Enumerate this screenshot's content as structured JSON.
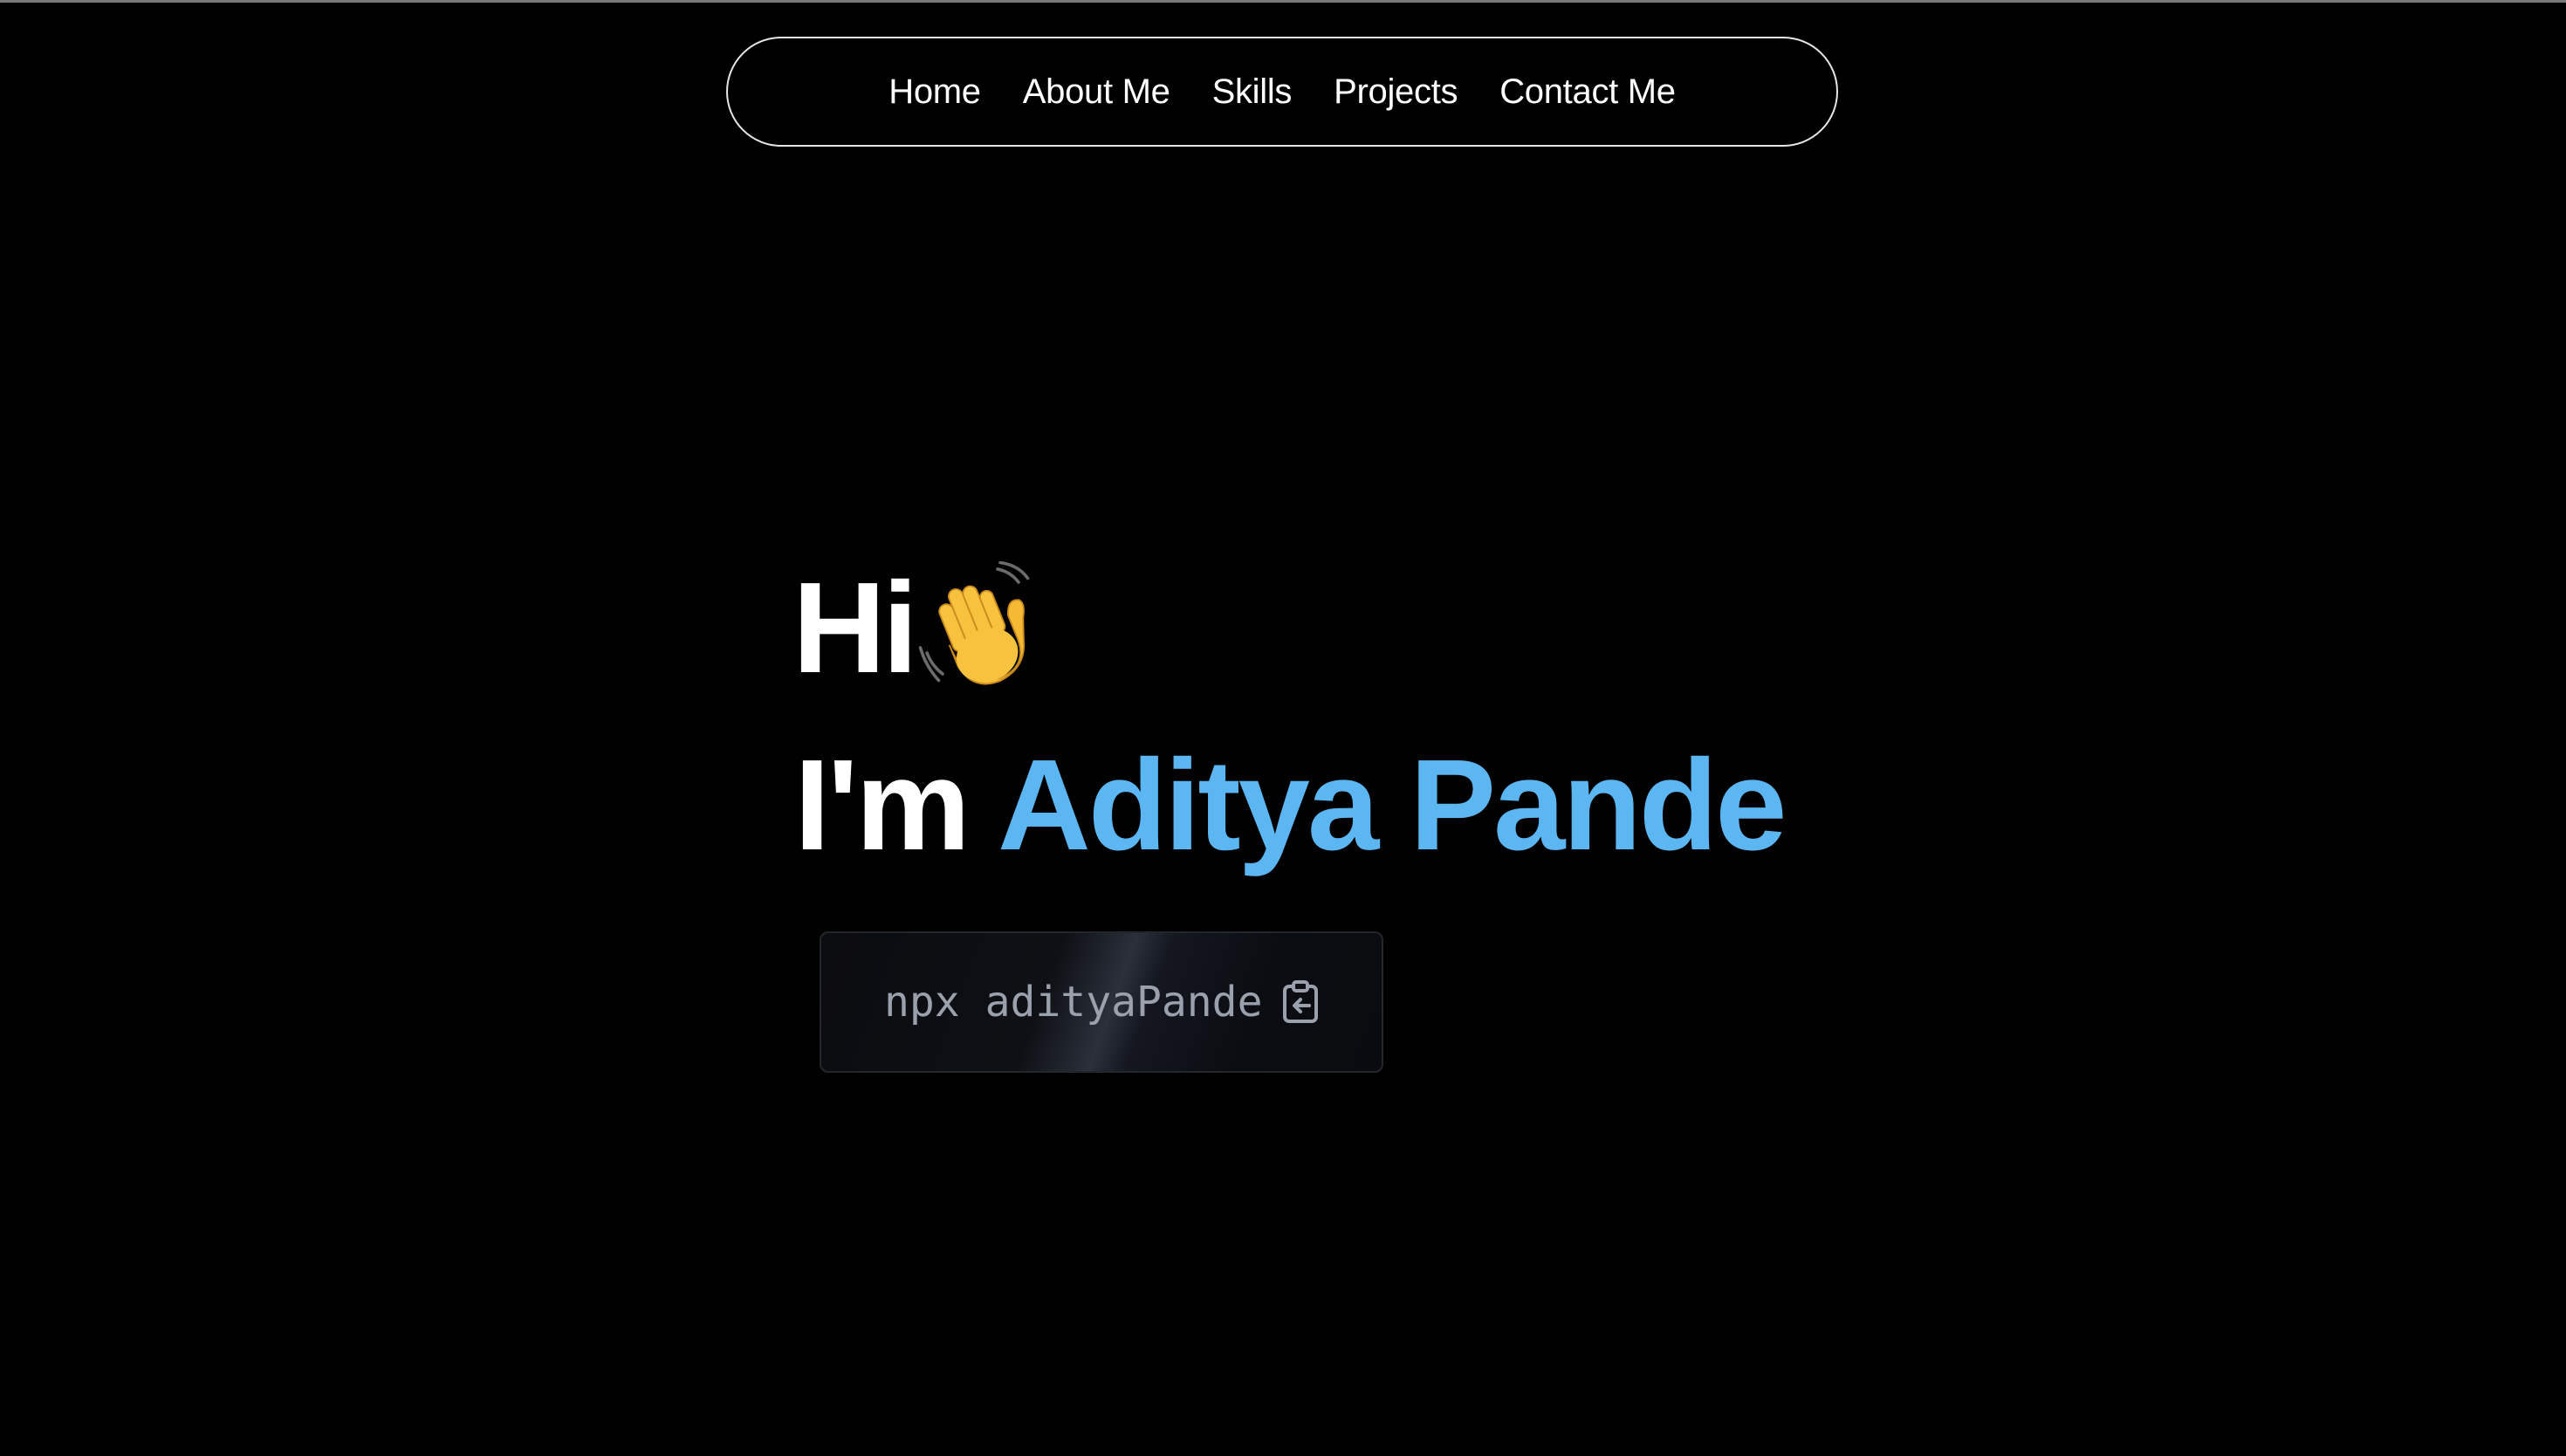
{
  "nav": {
    "items": [
      {
        "label": "Home"
      },
      {
        "label": "About Me"
      },
      {
        "label": "Skills"
      },
      {
        "label": "Projects"
      },
      {
        "label": "Contact Me"
      }
    ]
  },
  "hero": {
    "greeting": "Hi",
    "greeting_icon": "waving-hand-icon",
    "intro_prefix": "I'm",
    "name": "Aditya Pande",
    "name_color": "#5cb6f2",
    "command": "npx adityaPande",
    "copy_icon": "clipboard-copy-icon"
  },
  "colors": {
    "background": "#000000",
    "text": "#ffffff",
    "command_text": "#9aa1ad"
  }
}
